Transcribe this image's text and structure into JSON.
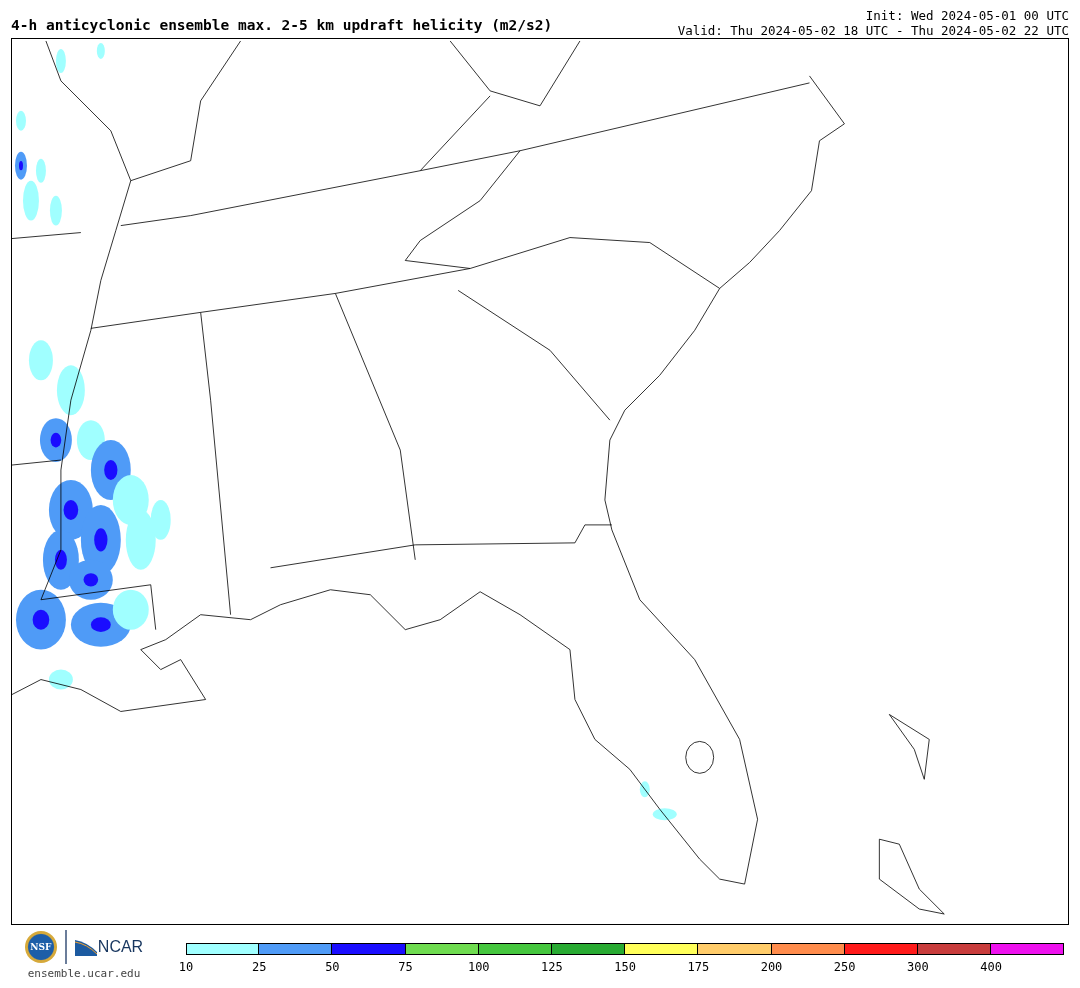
{
  "header": {
    "title": "4-h anticyclonic ensemble max. 2-5 km updraft helicity (m2/s2)",
    "init": "Init: Wed 2024-05-01 00 UTC",
    "valid": "Valid: Thu 2024-05-02 18 UTC - Thu 2024-05-02 22 UTC"
  },
  "footer": {
    "nsf_logo": "NSF",
    "ncar_logo": "NCAR",
    "site": "ensemble.ucar.edu"
  },
  "colorbar": [
    {
      "label": "10",
      "color": "#a0ffff"
    },
    {
      "label": "25",
      "color": "#4f9bf7"
    },
    {
      "label": "50",
      "color": "#1a0dff"
    },
    {
      "label": "75",
      "color": "#6fdc50"
    },
    {
      "label": "100",
      "color": "#45c63e"
    },
    {
      "label": "125",
      "color": "#28aa32"
    },
    {
      "label": "150",
      "color": "#ffff5a"
    },
    {
      "label": "175",
      "color": "#ffcc6a"
    },
    {
      "label": "200",
      "color": "#ff8c4c"
    },
    {
      "label": "250",
      "color": "#ff1a1a"
    },
    {
      "label": "300",
      "color": "#c83c3c"
    },
    {
      "label": "400",
      "color": "#ee11ee"
    }
  ]
}
